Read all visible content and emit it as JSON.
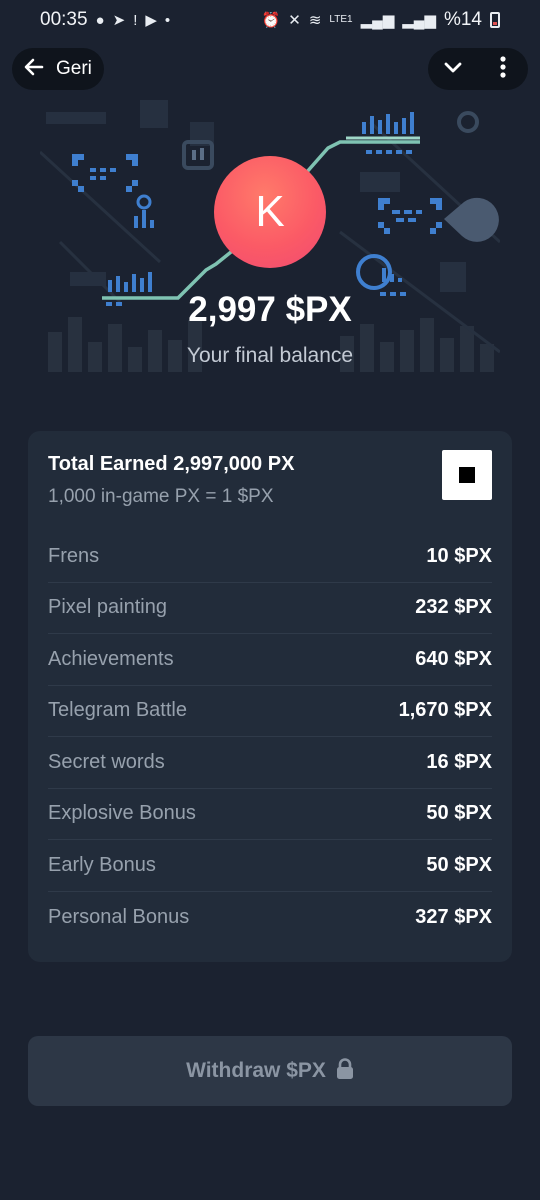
{
  "status_bar": {
    "time": "00:35",
    "battery": "%14",
    "network_label": "LTE1"
  },
  "nav": {
    "back_label": "Geri"
  },
  "hero": {
    "avatar_letter": "K",
    "balance": "2,997 $PX",
    "balance_caption": "Your final balance"
  },
  "summary": {
    "title": "Total Earned 2,997,000 PX",
    "rate": "1,000 in-game PX = 1 $PX",
    "rows": [
      {
        "label": "Frens",
        "value": "10 $PX"
      },
      {
        "label": "Pixel painting",
        "value": "232 $PX"
      },
      {
        "label": "Achievements",
        "value": "640 $PX"
      },
      {
        "label": "Telegram Battle",
        "value": "1,670 $PX"
      },
      {
        "label": "Secret words",
        "value": "16 $PX"
      },
      {
        "label": "Explosive Bonus",
        "value": "50 $PX"
      },
      {
        "label": "Early Bonus",
        "value": "50 $PX"
      },
      {
        "label": "Personal Bonus",
        "value": "327 $PX"
      }
    ]
  },
  "withdraw": {
    "label": "Withdraw $PX",
    "locked": true
  },
  "colors": {
    "background": "#1b2230",
    "card": "#222c3a",
    "avatar": "#fb5a66",
    "muted_text": "#97a1ad",
    "disabled_button": "#2d3746"
  }
}
